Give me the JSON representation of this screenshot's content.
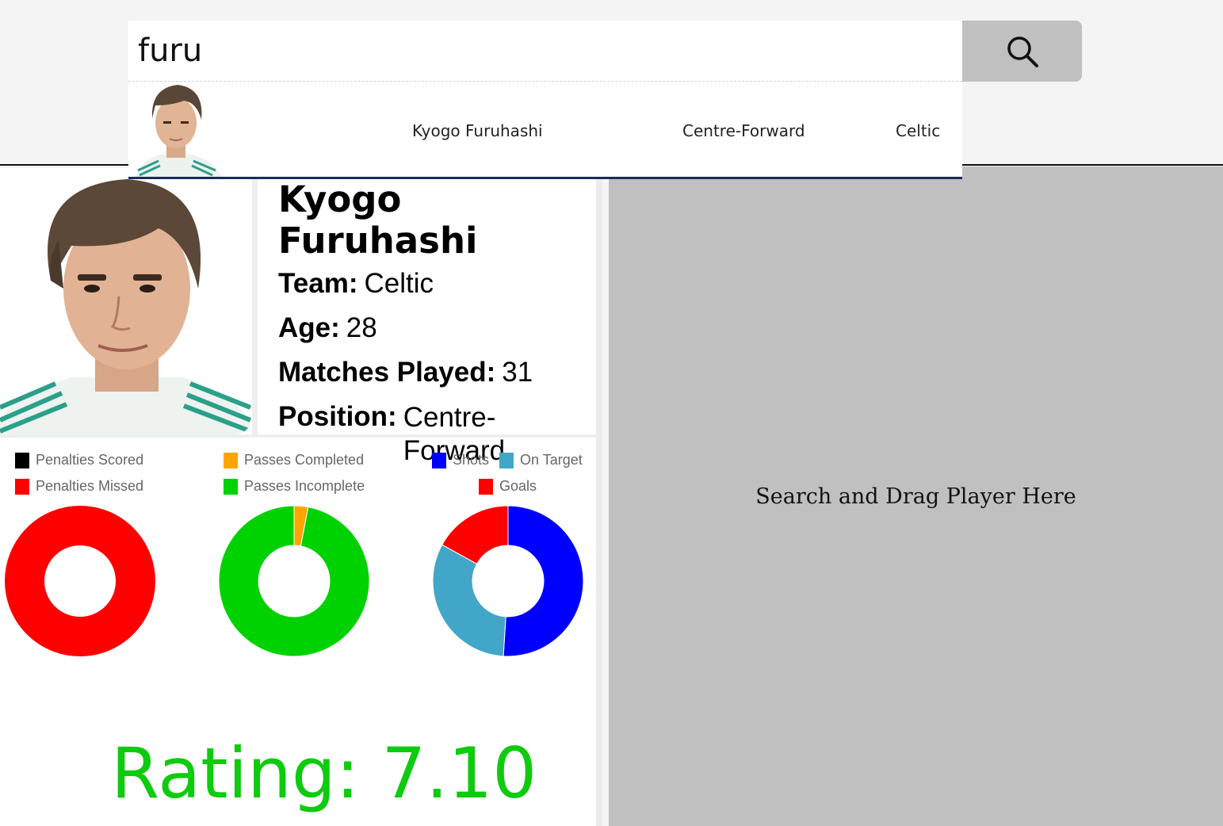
{
  "search": {
    "value": "furu",
    "button_icon": "search-icon"
  },
  "suggestions": [
    {
      "name": "Kyogo Furuhashi",
      "position": "Centre-Forward",
      "team": "Celtic"
    }
  ],
  "player": {
    "name": "Kyogo Furuhashi",
    "team_label": "Team:",
    "team": "Celtic",
    "age_label": "Age:",
    "age": "28",
    "matches_label": "Matches Played:",
    "matches": "31",
    "position_label": "Position:",
    "position_line1": "Centre-",
    "position_line2": "Forward",
    "rating_label": "Rating:",
    "rating": "7.10"
  },
  "colors": {
    "penalties_scored": "#000000",
    "penalties_missed": "#ff0000",
    "passes_completed": "#ffa500",
    "passes_incomplete": "#00d100",
    "shots": "#0000ff",
    "on_target": "#42a6c8",
    "goals": "#ff0000",
    "rating_text": "#0ecb0e"
  },
  "chart_data": [
    {
      "type": "pie",
      "labels": [
        "Penalties Scored",
        "Penalties Missed"
      ],
      "values": [
        0,
        1
      ],
      "colors": [
        "#000000",
        "#ff0000"
      ]
    },
    {
      "type": "pie",
      "labels": [
        "Passes Completed",
        "Passes Incomplete"
      ],
      "values": [
        3,
        97
      ],
      "colors": [
        "#ffa500",
        "#00d100"
      ]
    },
    {
      "type": "pie",
      "labels": [
        "Shots",
        "On Target",
        "Goals"
      ],
      "values": [
        51,
        32,
        17
      ],
      "colors": [
        "#0000ff",
        "#42a6c8",
        "#ff0000"
      ]
    }
  ],
  "dropzone": {
    "text": "Search and Drag Player Here"
  }
}
